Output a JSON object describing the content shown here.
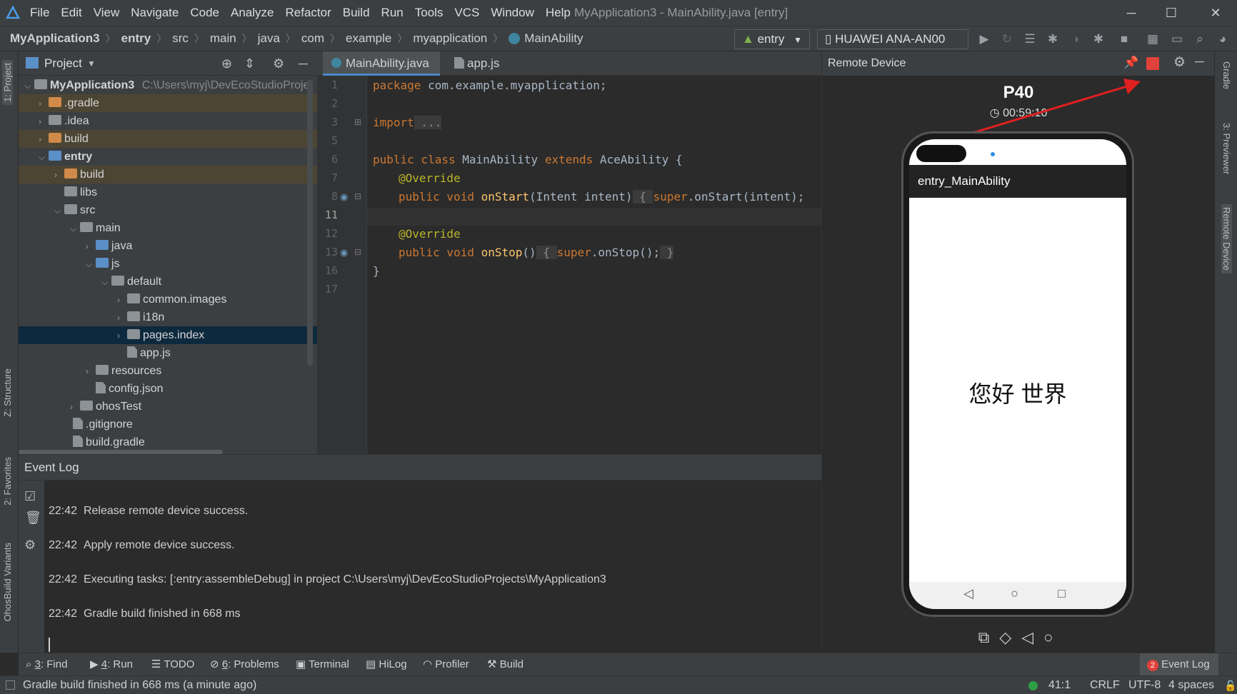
{
  "menubar": {
    "items": [
      "File",
      "Edit",
      "View",
      "Navigate",
      "Code",
      "Analyze",
      "Refactor",
      "Build",
      "Run",
      "Tools",
      "VCS",
      "Window",
      "Help"
    ],
    "title": "MyApplication3 - MainAbility.java [entry]"
  },
  "navbar": {
    "breadcrumbs": [
      "MyApplication3",
      "entry",
      "src",
      "main",
      "java",
      "com",
      "example",
      "myapplication",
      "MainAbility"
    ],
    "config": "entry",
    "device": "HUAWEI ANA-AN00"
  },
  "project": {
    "title": "Project",
    "root_label": "MyApplication3",
    "root_path": "C:\\Users\\myj\\DevEcoStudioProje",
    "rows": [
      {
        "label": ".gradle"
      },
      {
        "label": ".idea"
      },
      {
        "label": "build"
      },
      {
        "label": "entry"
      },
      {
        "label": "build"
      },
      {
        "label": "libs"
      },
      {
        "label": "src"
      },
      {
        "label": "main"
      },
      {
        "label": "java"
      },
      {
        "label": "js"
      },
      {
        "label": "default"
      },
      {
        "label": "common.images"
      },
      {
        "label": "i18n"
      },
      {
        "label": "pages.index"
      },
      {
        "label": "app.js"
      },
      {
        "label": "resources"
      },
      {
        "label": "config.json"
      },
      {
        "label": "ohosTest"
      },
      {
        "label": ".gitignore"
      },
      {
        "label": "build.gradle"
      }
    ]
  },
  "editor": {
    "tabs": [
      "MainAbility.java",
      "app.js"
    ],
    "line_numbers": [
      "1",
      "2",
      "3",
      "5",
      "6",
      "7",
      "8",
      "11",
      "12",
      "13",
      "16",
      "17"
    ],
    "code": {
      "l1_kw": "package",
      "l1_rest": " com.example.myapplication;",
      "l3_kw": "import",
      "l3_fold": " ...",
      "l6_a": "public class",
      "l6_b": " MainAbility ",
      "l6_c": "extends",
      "l6_d": " AceAbility {",
      "l7_an": "@Override",
      "l8_kw": "public void",
      "l8_fn": "onStart",
      "l8_args": "(Intent intent)",
      "l8_fold": " { ",
      "l8_super": "super",
      "l8_rest": ".onStart(intent);",
      "l12_an": "@Override",
      "l13_kw": "public void",
      "l13_fn": "onStop",
      "l13_args": "()",
      "l13_fold": " { ",
      "l13_super": "super",
      "l13_rest": ".onStop();",
      "l13_close": " }",
      "l16": "}"
    }
  },
  "eventlog": {
    "title": "Event Log",
    "entries": [
      {
        "time": "22:42",
        "message": "Release remote device success."
      },
      {
        "time": "22:42",
        "message": "Apply remote device success."
      },
      {
        "time": "22:42",
        "message": "Executing tasks: [:entry:assembleDebug] in project C:\\Users\\myj\\DevEcoStudioProjects\\MyApplication3"
      },
      {
        "time": "22:42",
        "message": "Gradle build finished in 668 ms"
      }
    ]
  },
  "bottom_tools": [
    {
      "key": "3",
      "label": ": Find"
    },
    {
      "key": "4",
      "label": ": Run"
    },
    {
      "key": "",
      "label": "TODO"
    },
    {
      "key": "6",
      "label": ": Problems"
    },
    {
      "key": "",
      "label": "Terminal"
    },
    {
      "key": "",
      "label": "HiLog"
    },
    {
      "key": "",
      "label": "Profiler"
    },
    {
      "key": "",
      "label": "Build"
    }
  ],
  "event_log_badge": {
    "count": "2",
    "label": "Event Log"
  },
  "status": {
    "message": "Gradle build finished in 668 ms (a minute ago)",
    "position": "41:1",
    "line_sep": "CRLF",
    "encoding": "UTF-8",
    "indent": "4 spaces"
  },
  "remote": {
    "title": "Remote Device",
    "device_name": "P40",
    "timer": "00:59:10",
    "app_title": "entry_MainAbility",
    "content": "您好 世界"
  },
  "left_stripe": [
    "1: Project",
    "Z: Structure",
    "2: Favorites",
    "OhosBuild Variants"
  ],
  "right_stripe": [
    "Gradle",
    "3: Previewer",
    "Remote Device"
  ],
  "colors": {
    "accent": "#4a88c7",
    "stop_red": "#e0413a",
    "arrow_red": "#e02020",
    "status_green": "#2ea043"
  }
}
